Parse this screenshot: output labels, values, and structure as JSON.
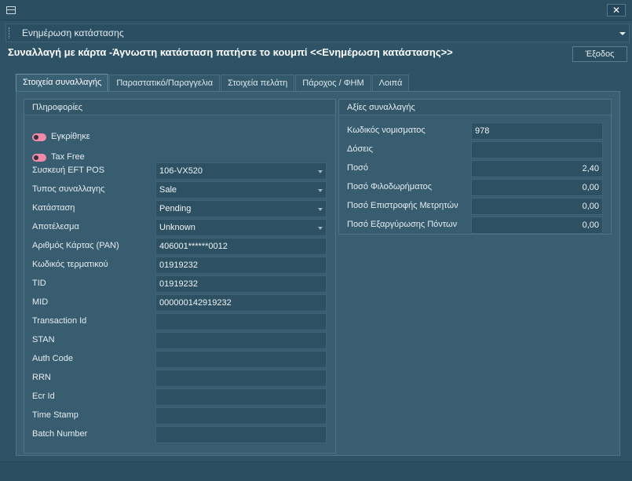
{
  "window": {
    "close_label": "✕"
  },
  "status_combo": {
    "value": "Ενημέρωση κατάστασης"
  },
  "headline": "Συναλλαγή με κάρτα -Άγνωστη κατάσταση πατήστε το κουμπί <<Ενημέρωση κατάστασης>>",
  "exit_button": "Έξοδος",
  "tabs": [
    {
      "label": "Στοιχεία συναλλαγής",
      "active": true
    },
    {
      "label": "Παραστατικό/Παραγγελια",
      "active": false
    },
    {
      "label": "Στοιχεία πελάτη",
      "active": false
    },
    {
      "label": "Πάροχος / ΦΗΜ",
      "active": false
    },
    {
      "label": "Λοιπά",
      "active": false
    }
  ],
  "info": {
    "title": "Πληροφορίες",
    "toggles": [
      {
        "label": "Εγκρίθηκε",
        "on": true
      },
      {
        "label": "Tax Free",
        "on": true
      }
    ],
    "fields": [
      {
        "label": "Συσκευή EFT POS",
        "value": "106-VX520",
        "dropdown": true
      },
      {
        "label": "Τυπος συναλλαγης",
        "value": "Sale",
        "dropdown": true
      },
      {
        "label": "Κατάσταση",
        "value": "Pending",
        "dropdown": true
      },
      {
        "label": "Αποτέλεσμα",
        "value": "Unknown",
        "dropdown": true
      },
      {
        "label": "Αριθμός Κάρτας (PAN)",
        "value": "406001******0012",
        "dropdown": false
      },
      {
        "label": "Κωδικός τερματικού",
        "value": "01919232",
        "dropdown": false
      },
      {
        "label": "TID",
        "value": "01919232",
        "dropdown": false
      },
      {
        "label": "MID",
        "value": "000000142919232",
        "dropdown": false
      },
      {
        "label": "Transaction Id",
        "value": "",
        "dropdown": false
      },
      {
        "label": "STAN",
        "value": "",
        "dropdown": false
      },
      {
        "label": "Auth Code",
        "value": "",
        "dropdown": false
      },
      {
        "label": "RRN",
        "value": "",
        "dropdown": false
      },
      {
        "label": "Ecr Id",
        "value": "",
        "dropdown": false
      },
      {
        "label": "Time Stamp",
        "value": "",
        "dropdown": false
      },
      {
        "label": "Batch Number",
        "value": "",
        "dropdown": false
      }
    ]
  },
  "values": {
    "title": "Αξίες συναλλαγής",
    "fields": [
      {
        "label": "Κωδικός νομισματος",
        "value": "978",
        "numeric": false
      },
      {
        "label": "Δόσεις",
        "value": "",
        "numeric": false
      },
      {
        "label": "Ποσό",
        "value": "2,40",
        "numeric": true
      },
      {
        "label": "Ποσό Φιλοδωρήματος",
        "value": "0,00",
        "numeric": true
      },
      {
        "label": "Ποσό Επιστροφής Μετρητών",
        "value": "0,00",
        "numeric": true
      },
      {
        "label": "Ποσό Εξαργύρωσης Πόντων",
        "value": "0,00",
        "numeric": true
      }
    ]
  }
}
